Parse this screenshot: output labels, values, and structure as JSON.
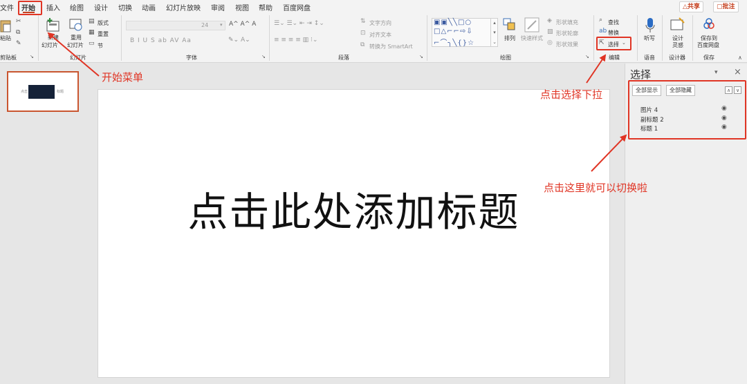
{
  "tabs": [
    "文件",
    "开始",
    "插入",
    "绘图",
    "设计",
    "切换",
    "动画",
    "幻灯片放映",
    "审阅",
    "视图",
    "帮助",
    "百度网盘"
  ],
  "topright": {
    "share": "△共享",
    "comment": "▢批注"
  },
  "ribbon": {
    "clipboard": {
      "paste": "粘贴",
      "group": "剪贴板"
    },
    "slides": {
      "new_line1": "新建",
      "new_line2": "幻灯片",
      "reuse_line1": "重用",
      "reuse_line2": "幻灯片",
      "layout": "版式",
      "reset": "重置",
      "section": "节",
      "group": "幻灯片"
    },
    "font": {
      "size": "24",
      "group": "字体",
      "row2": "B  I  U  S  ab  AV  Aa",
      "grow": "A^ A^ A"
    },
    "paragraph": {
      "textdir": "文字方向",
      "align": "对齐文本",
      "smartart": "转换为 SmartArt",
      "group": "段落"
    },
    "drawing": {
      "arrange": "排列",
      "quickstyle": "快速样式",
      "fill": "形状填充",
      "outline": "形状轮廓",
      "effect": "形状效果",
      "group": "绘图"
    },
    "editing": {
      "find": "查找",
      "replace": "替换",
      "select": "选择",
      "group": "编辑"
    },
    "voice": {
      "dictate": "听写",
      "group": "语音"
    },
    "designer": {
      "label_line1": "设计",
      "label_line2": "灵感",
      "group": "设计器"
    },
    "save": {
      "label_line1": "保存到",
      "label_line2": "百度网盘",
      "group": "保存"
    }
  },
  "thumbnail": {
    "left_text": "点击",
    "right_text": "标题"
  },
  "slide": {
    "title": "点击此处添加标题"
  },
  "selection_pane": {
    "title": "选择",
    "show_all": "全部显示",
    "hide_all": "全部隐藏",
    "objects": [
      "图片 4",
      "副标题 2",
      "标题 1"
    ]
  },
  "annotations": {
    "start_menu": "开始菜单",
    "click_select": "点击选择下拉",
    "switch_here": "点击这里就可以切换啦"
  },
  "colors": {
    "accent": "#c43e1c",
    "annotation": "#e03424"
  }
}
